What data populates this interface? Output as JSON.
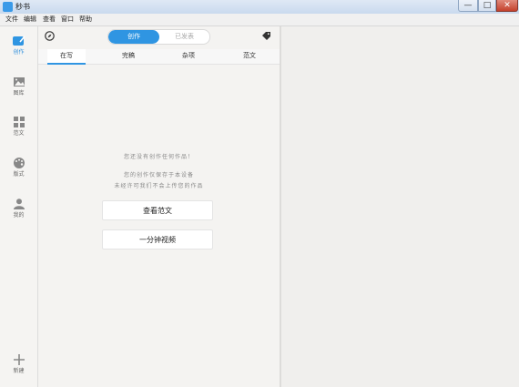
{
  "window": {
    "title": "秒书",
    "min": "—",
    "max": "□",
    "close": "✕"
  },
  "menu": [
    "文件",
    "编辑",
    "查看",
    "窗口",
    "帮助"
  ],
  "sidebar": {
    "items": [
      {
        "label": "创作",
        "icon": "edit-icon",
        "active": true
      },
      {
        "label": "图库",
        "icon": "image-icon",
        "active": false
      },
      {
        "label": "范文",
        "icon": "grid-icon",
        "active": false
      },
      {
        "label": "版式",
        "icon": "palette-icon",
        "active": false
      },
      {
        "label": "我的",
        "icon": "user-icon",
        "active": false
      }
    ],
    "new_label": "新建",
    "new_icon": "plus-icon"
  },
  "header": {
    "segment_active": "创作",
    "segment_inactive": "已发表"
  },
  "tabs": [
    "在写",
    "完稿",
    "杂项",
    "范文"
  ],
  "empty": {
    "line1": "您还没有创作任何作品！",
    "line2": "您的创作仅保存于本设备",
    "line3": "未经许可我们不会上传您的作品"
  },
  "buttons": {
    "view_samples": "查看范文",
    "video": "一分钟视频"
  },
  "colors": {
    "accent": "#2f95e2",
    "panel_bg": "#f4f3f1",
    "right_bg": "#f0efed"
  }
}
